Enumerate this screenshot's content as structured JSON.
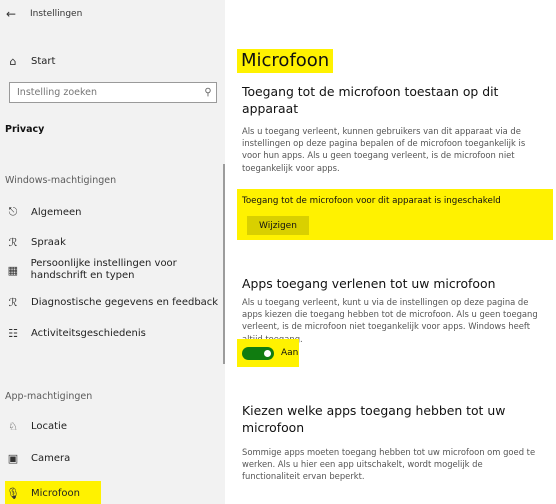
{
  "window": {
    "title": "Instellingen",
    "back_icon": "back-arrow-icon"
  },
  "sidebar": {
    "home_label": "Start",
    "search": {
      "placeholder": "Instelling zoeken",
      "value": ""
    },
    "privacy_heading": "Privacy",
    "windows_section": "Windows-machtigingen",
    "windows_items": [
      {
        "label": "Algemeen",
        "icon": "lock-icon"
      },
      {
        "label": "Spraak",
        "icon": "speech-icon"
      },
      {
        "label": "Persoonlijke instellingen voor handschrift en typen",
        "icon": "clipboard-icon"
      },
      {
        "label": "Diagnostische gegevens en feedback",
        "icon": "feedback-icon"
      },
      {
        "label": "Activiteitsgeschiedenis",
        "icon": "timeline-icon"
      }
    ],
    "app_section": "App-machtigingen",
    "app_items": [
      {
        "label": "Locatie",
        "icon": "location-icon"
      },
      {
        "label": "Camera",
        "icon": "camera-icon"
      },
      {
        "label": "Microfoon",
        "icon": "microphone-icon",
        "active": true
      }
    ]
  },
  "main": {
    "title": "Microfoon",
    "section1": {
      "heading": "Toegang tot de microfoon toestaan op dit apparaat",
      "body": "Als u toegang verleent, kunnen gebruikers van dit apparaat via de instellingen op deze pagina bepalen of de microfoon toegankelijk is voor hun apps. Als u geen toegang verleent, is de microfoon niet toegankelijk voor apps.",
      "notice": "Toegang tot de microfoon voor dit apparaat is ingeschakeld",
      "button_label": "Wijzigen"
    },
    "section2": {
      "heading": "Apps toegang verlenen tot uw microfoon",
      "body": "Als u toegang verleent, kunt u via de instellingen op deze pagina de apps kiezen die toegang hebben tot de microfoon. Als u geen toegang verleent, is de microfoon niet toegankelijk voor apps. Windows heeft altijd toegang.",
      "toggle_label": "Aan",
      "toggle_on": true
    },
    "section3": {
      "heading": "Kiezen welke apps toegang hebben tot uw microfoon",
      "body": "Sommige apps moeten toegang hebben tot uw microfoon om goed te werken. Als u hier een app uitschakelt, wordt mogelijk de functionaliteit ervan beperkt."
    }
  },
  "colors": {
    "highlight": "#fff200",
    "toggle_on": "#107c10",
    "sidebar_bg": "#f2f2f2"
  }
}
